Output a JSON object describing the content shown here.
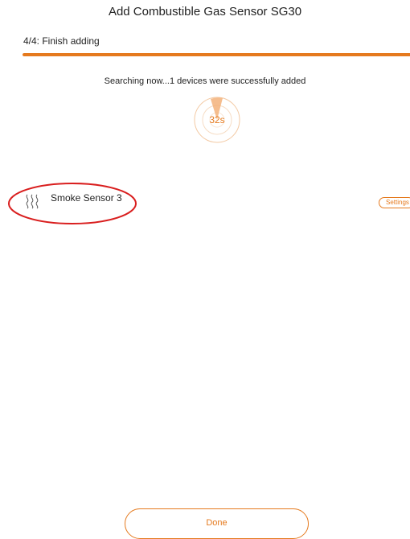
{
  "header": {
    "title": "Add Combustible Gas Sensor SG30"
  },
  "step": {
    "label": "4/4: Finish adding",
    "progress_fraction": 1.0
  },
  "search": {
    "status_text": "Searching now...1 devices were successfully added",
    "countdown": "32s"
  },
  "devices": [
    {
      "name": "Smoke Sensor 3",
      "icon": "smoke-icon",
      "action_label": "Settings",
      "highlighted": true
    }
  ],
  "footer": {
    "done_label": "Done"
  },
  "colors": {
    "accent": "#e57a1e",
    "progress_track": "#f4d2b4",
    "highlight_circle": "#d91e1e",
    "text": "#222222"
  }
}
